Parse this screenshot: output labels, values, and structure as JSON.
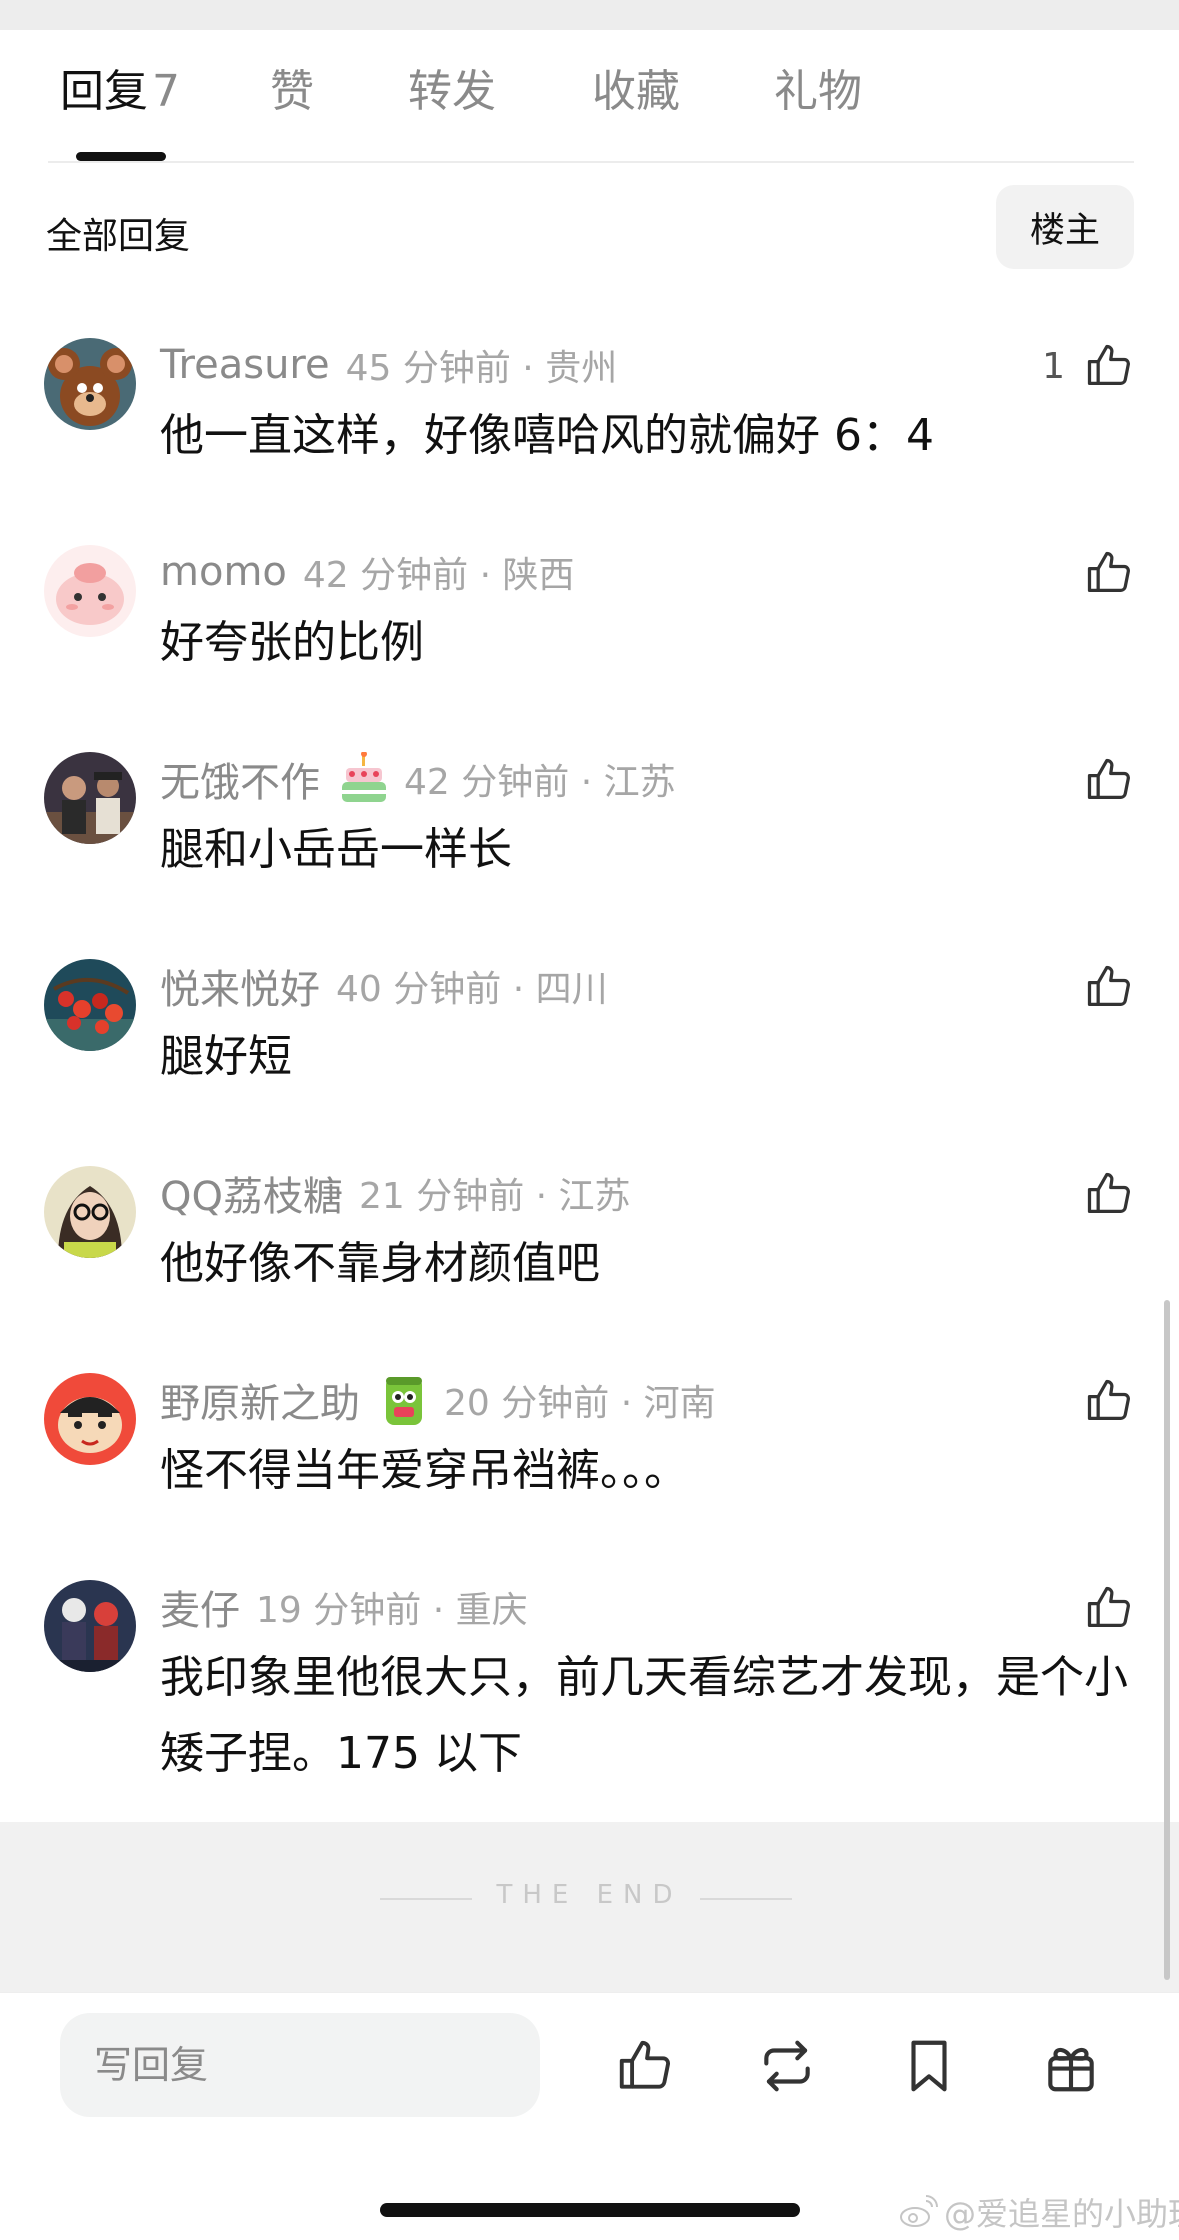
{
  "tabs": [
    {
      "label": "回复",
      "count": "7"
    },
    {
      "label": "赞"
    },
    {
      "label": "转发"
    },
    {
      "label": "收藏"
    },
    {
      "label": "礼物"
    }
  ],
  "subheader": {
    "title": "全部回复",
    "op_button": "楼主"
  },
  "comments": [
    {
      "username": "Treasure",
      "time_location": "45 分钟前 · 贵州",
      "text": "他一直这样，好像嘻哈风的就偏好 6：4",
      "likes": "1",
      "avatar": "jerry-mouse-avatar"
    },
    {
      "username": "momo",
      "time_location": "42 分钟前 · 陕西",
      "text": "好夸张的比例",
      "likes": "",
      "avatar": "pink-blob-avatar"
    },
    {
      "username": "无饿不作",
      "time_location": "42 分钟前 · 江苏",
      "text": "腿和小岳岳一样长",
      "likes": "",
      "avatar": "movie-still-avatar",
      "badge": "cake-badge-icon"
    },
    {
      "username": "悦来悦好",
      "time_location": "40 分钟前 · 四川",
      "text": "腿好短",
      "likes": "",
      "avatar": "red-berries-avatar"
    },
    {
      "username": "QQ荔枝糖",
      "time_location": "21 分钟前 · 江苏",
      "text": "他好像不靠身材颜值吧",
      "likes": "",
      "avatar": "girl-glasses-avatar"
    },
    {
      "username": "野原新之助",
      "time_location": "20 分钟前 · 河南",
      "text": "怪不得当年爱穿吊裆裤。。。",
      "likes": "",
      "avatar": "crayon-shin-chan-avatar",
      "badge": "green-can-badge-icon"
    },
    {
      "username": "麦仔",
      "time_location": "19 分钟前 · 重庆",
      "text": "我印象里他很大只，前几天看综艺才发现，是个小矮子捏。175 以下",
      "likes": "",
      "avatar": "anime-figures-avatar"
    }
  ],
  "end_text": "THE END",
  "bottom_bar": {
    "reply_placeholder": "写回复",
    "icons": [
      "like-icon",
      "repost-icon",
      "bookmark-icon",
      "gift-icon"
    ]
  },
  "watermark": "@爱追星的小助理",
  "colors": {
    "accent": "#111111",
    "muted": "#8a8a8a",
    "end_bg": "#f1f1f1"
  }
}
